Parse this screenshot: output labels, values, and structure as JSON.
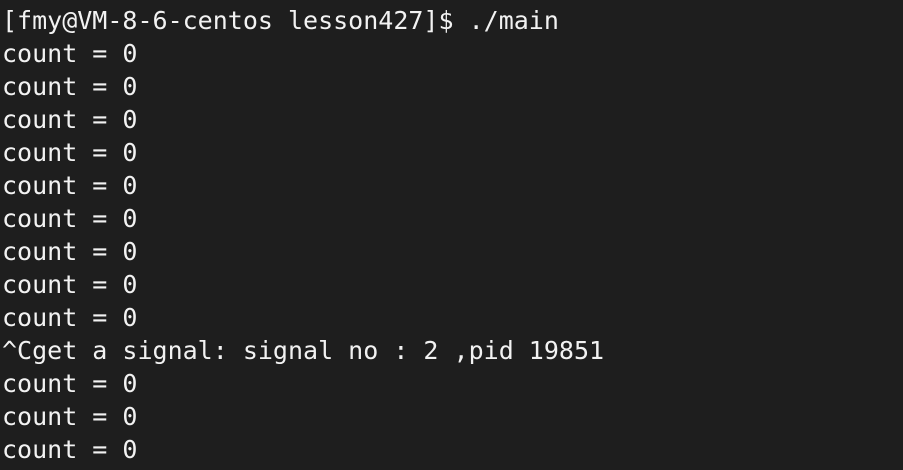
{
  "terminal": {
    "prompt_line": "[fmy@VM-8-6-centos lesson427]$ ./main",
    "output_lines": [
      "count = 0",
      "count = 0",
      "count = 0",
      "count = 0",
      "count = 0",
      "count = 0",
      "count = 0",
      "count = 0",
      "count = 0",
      "^Cget a signal: signal no : 2 ,pid 19851",
      "count = 0",
      "count = 0",
      "count = 0"
    ]
  }
}
